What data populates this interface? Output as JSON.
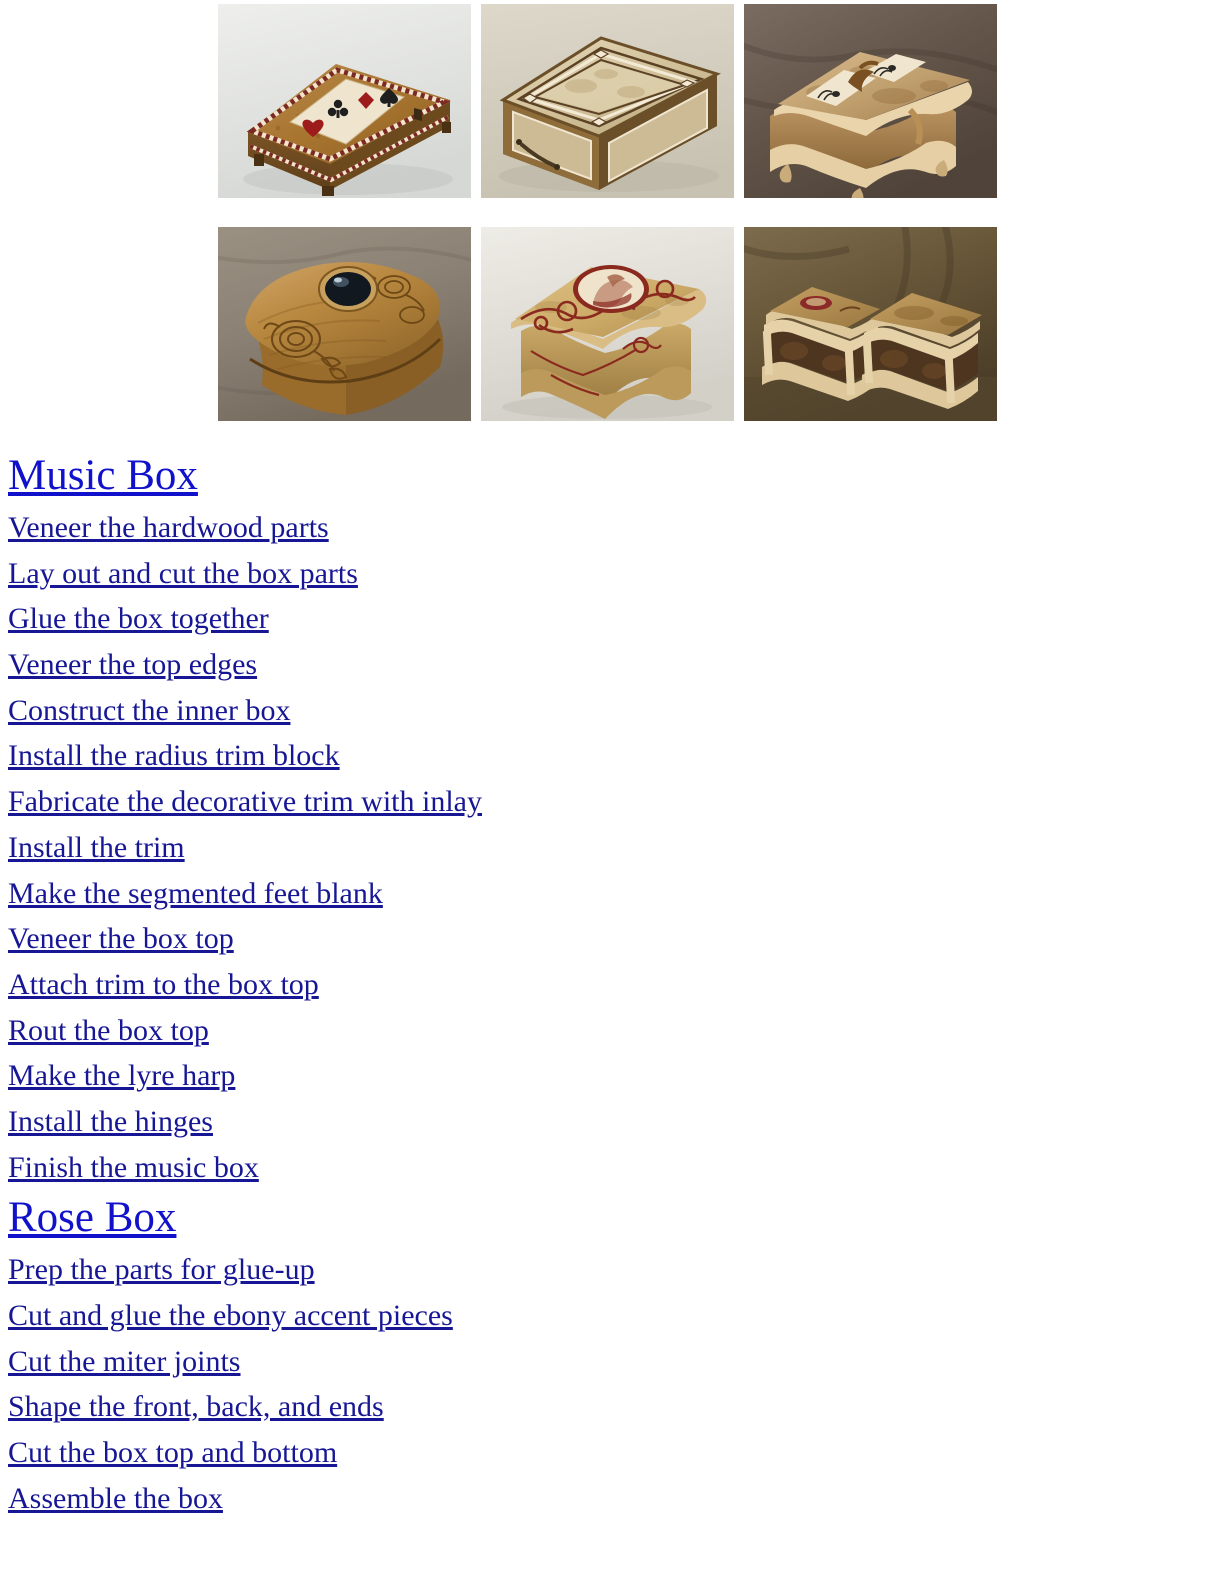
{
  "gallery": {
    "rows": [
      [
        {
          "name": "card-suit-inlay-box",
          "alt": "Burl wood box with playing card suit inlay on lid and checkered banding",
          "background": "#e8e9e7",
          "surface": "#dadbd8"
        },
        {
          "name": "geometric-inlay-box",
          "alt": "Square inlaid box with geometric Greek key border on lid and sides",
          "background": "#d9d4c6",
          "surface": "#cfc9ba"
        },
        {
          "name": "lyre-harp-music-box",
          "alt": "Serpentine music box with lyre harp inlay on lid, shown on brown cloth",
          "background": "#6d6057",
          "surface": "#5d5048"
        }
      ],
      [
        {
          "name": "carved-rose-box",
          "alt": "Carved rose box with black oval cabochon stone set in the domed lid",
          "background": "#8e8377",
          "surface": "#7e7367"
        },
        {
          "name": "vine-inlay-cameo-box",
          "alt": "Burl box with red vine inlay and oval cameo medallion on the lid",
          "background": "#e4e2dc",
          "surface": "#d6d3cb"
        },
        {
          "name": "pair-of-trim-boxes",
          "alt": "Pair of matching ornate boxes with cream maple trim and dark burl panels",
          "background": "#6a5b46",
          "surface": "#5a4c3a"
        }
      ]
    ]
  },
  "sections": [
    {
      "id": "music-box",
      "title": "Music Box",
      "links": [
        "Veneer the hardwood parts",
        "Lay out and cut the box parts",
        "Glue the box together",
        "Veneer the top edges",
        "Construct the inner box",
        "Install the radius trim block",
        "Fabricate the decorative trim with inlay",
        "Install the trim",
        "Make the segmented feet blank",
        "Veneer the box top",
        "Attach trim to the box top",
        "Rout the box top",
        "Make the lyre harp",
        "Install the hinges",
        "Finish the music box"
      ]
    },
    {
      "id": "rose-box",
      "title": "Rose Box",
      "links": [
        "Prep the parts for glue-up",
        "Cut and glue the ebony accent pieces",
        "Cut the miter joints",
        "Shape the front, back, and ends",
        "Cut the box top and bottom",
        "Assemble the box"
      ]
    }
  ],
  "colors": {
    "heading_link": "#1111CC",
    "body_link": "#171796",
    "page_background": "#FFFFFF"
  }
}
